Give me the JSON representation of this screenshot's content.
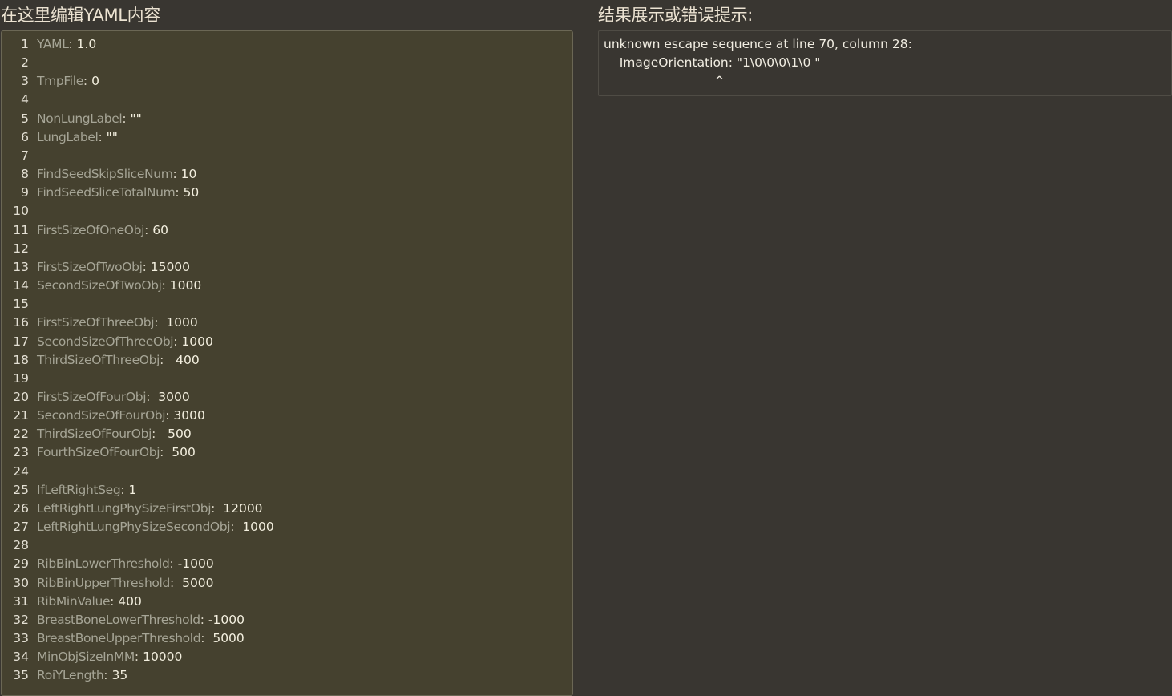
{
  "editor_panel": {
    "title": "在这里编辑YAML内容",
    "lines": [
      {
        "num": "1",
        "key": "YAML",
        "sep": ": ",
        "value": "1.0"
      },
      {
        "num": "2",
        "key": "",
        "sep": "",
        "value": ""
      },
      {
        "num": "3",
        "key": "TmpFile",
        "sep": ": ",
        "value": "0"
      },
      {
        "num": "4",
        "key": "",
        "sep": "",
        "value": ""
      },
      {
        "num": "5",
        "key": "NonLungLabel",
        "sep": ": ",
        "value": "\"\""
      },
      {
        "num": "6",
        "key": "LungLabel",
        "sep": ": ",
        "value": "\"\""
      },
      {
        "num": "7",
        "key": "",
        "sep": "",
        "value": ""
      },
      {
        "num": "8",
        "key": "FindSeedSkipSliceNum",
        "sep": ": ",
        "value": "10"
      },
      {
        "num": "9",
        "key": "FindSeedSliceTotalNum",
        "sep": ": ",
        "value": "50"
      },
      {
        "num": "10",
        "key": "",
        "sep": "",
        "value": ""
      },
      {
        "num": "11",
        "key": "FirstSizeOfOneObj",
        "sep": ": ",
        "value": "60"
      },
      {
        "num": "12",
        "key": "",
        "sep": "",
        "value": ""
      },
      {
        "num": "13",
        "key": "FirstSizeOfTwoObj",
        "sep": ": ",
        "value": "15000"
      },
      {
        "num": "14",
        "key": "SecondSizeOfTwoObj",
        "sep": ": ",
        "value": "1000"
      },
      {
        "num": "15",
        "key": "",
        "sep": "",
        "value": ""
      },
      {
        "num": "16",
        "key": "FirstSizeOfThreeObj",
        "sep": ":  ",
        "value": "1000"
      },
      {
        "num": "17",
        "key": "SecondSizeOfThreeObj",
        "sep": ": ",
        "value": "1000"
      },
      {
        "num": "18",
        "key": "ThirdSizeOfThreeObj",
        "sep": ":   ",
        "value": "400"
      },
      {
        "num": "19",
        "key": "",
        "sep": "",
        "value": ""
      },
      {
        "num": "20",
        "key": "FirstSizeOfFourObj",
        "sep": ":  ",
        "value": "3000"
      },
      {
        "num": "21",
        "key": "SecondSizeOfFourObj",
        "sep": ": ",
        "value": "3000"
      },
      {
        "num": "22",
        "key": "ThirdSizeOfFourObj",
        "sep": ":   ",
        "value": "500"
      },
      {
        "num": "23",
        "key": "FourthSizeOfFourObj",
        "sep": ":  ",
        "value": "500"
      },
      {
        "num": "24",
        "key": "",
        "sep": "",
        "value": ""
      },
      {
        "num": "25",
        "key": "IfLeftRightSeg",
        "sep": ": ",
        "value": "1"
      },
      {
        "num": "26",
        "key": "LeftRightLungPhySizeFirstObj",
        "sep": ":  ",
        "value": "12000"
      },
      {
        "num": "27",
        "key": "LeftRightLungPhySizeSecondObj",
        "sep": ":  ",
        "value": "1000"
      },
      {
        "num": "28",
        "key": "",
        "sep": "",
        "value": ""
      },
      {
        "num": "29",
        "key": "RibBinLowerThreshold",
        "sep": ": ",
        "value": "-1000"
      },
      {
        "num": "30",
        "key": "RibBinUpperThreshold",
        "sep": ":  ",
        "value": "5000"
      },
      {
        "num": "31",
        "key": "RibMinValue",
        "sep": ": ",
        "value": "400"
      },
      {
        "num": "32",
        "key": "BreastBoneLowerThreshold",
        "sep": ": ",
        "value": "-1000"
      },
      {
        "num": "33",
        "key": "BreastBoneUpperThreshold",
        "sep": ":  ",
        "value": "5000"
      },
      {
        "num": "34",
        "key": "MinObjSizeInMM",
        "sep": ": ",
        "value": "10000"
      },
      {
        "num": "35",
        "key": "RoiYLength",
        "sep": ": ",
        "value": "35"
      }
    ]
  },
  "result_panel": {
    "title": "结果展示或错误提示:",
    "message_lines": [
      "unknown escape sequence at line 70, column 28:",
      "    ImageOrientation: \"1\\0\\0\\0\\1\\0 \"",
      "                            ^"
    ]
  }
}
